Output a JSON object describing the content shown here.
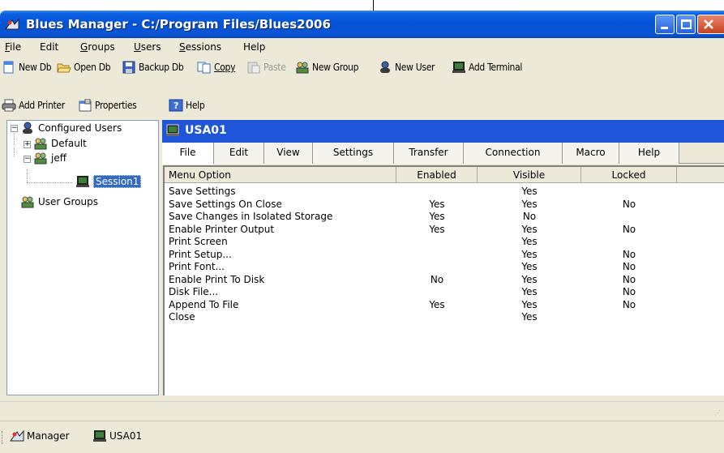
{
  "window": {
    "title": "Blues Manager - C:/Program Files/Blues2006"
  },
  "menubar": [
    {
      "label": "File",
      "u": "F",
      "rest": "ile"
    },
    {
      "label": "Edit",
      "u": "",
      "rest": "Edit"
    },
    {
      "label": "Groups",
      "u": "G",
      "rest": "roups"
    },
    {
      "label": "Users",
      "u": "U",
      "rest": "sers"
    },
    {
      "label": "Sessions",
      "u": "S",
      "rest": "essions"
    },
    {
      "label": "Help",
      "u": "",
      "rest": "Help"
    }
  ],
  "toolbar": {
    "new_db": "New Db",
    "open_db": "Open Db",
    "backup_db": "Backup Db",
    "copy": "Copy",
    "paste": "Paste",
    "new_group": "New Group",
    "new_user": "New User",
    "add_terminal": "Add Terminal",
    "add_printer": "Add Printer",
    "properties": "Properties",
    "help": "Help"
  },
  "tree": {
    "root": "Configured Users",
    "default": "Default",
    "jeff": "jeff",
    "session": "Session1",
    "groups": "User Groups"
  },
  "panel": {
    "title": "USA01"
  },
  "tabs": [
    "File",
    "Edit",
    "View",
    "Settings",
    "Transfer",
    "Connection",
    "Macro",
    "Help"
  ],
  "grid": {
    "columns": [
      "Menu Option",
      "Enabled",
      "Visible",
      "Locked"
    ],
    "rows": [
      [
        "Save Settings",
        "",
        "Yes",
        ""
      ],
      [
        "Save Settings On Close",
        "Yes",
        "Yes",
        "No"
      ],
      [
        "Save Changes in Isolated Storage",
        "Yes",
        "No",
        ""
      ],
      [
        "Enable Printer Output",
        "Yes",
        "Yes",
        "No"
      ],
      [
        "Print Screen",
        "",
        "Yes",
        ""
      ],
      [
        "Print Setup...",
        "",
        "Yes",
        "No"
      ],
      [
        "Print Font...",
        "",
        "Yes",
        "No"
      ],
      [
        "Enable Print To Disk",
        "No",
        "Yes",
        "No"
      ],
      [
        "Disk File...",
        "",
        "Yes",
        "No"
      ],
      [
        "Append To File",
        "Yes",
        "Yes",
        "No"
      ],
      [
        "Close",
        "",
        "Yes",
        ""
      ]
    ]
  },
  "taskbar": {
    "manager": "Manager",
    "usa01": "USA01"
  },
  "colors": {
    "titlebar": "#0553d6",
    "panel_header": "#1f55d8",
    "selection": "#316ac5",
    "face": "#ece9d8"
  },
  "icons": [
    "app-icon",
    "minimize-icon",
    "maximize-icon",
    "close-icon",
    "new-db-icon",
    "open-folder-icon",
    "floppy-icon",
    "copy-icon",
    "paste-icon",
    "group-icon",
    "user-icon",
    "terminal-icon",
    "printer-icon",
    "properties-icon",
    "help-icon"
  ]
}
